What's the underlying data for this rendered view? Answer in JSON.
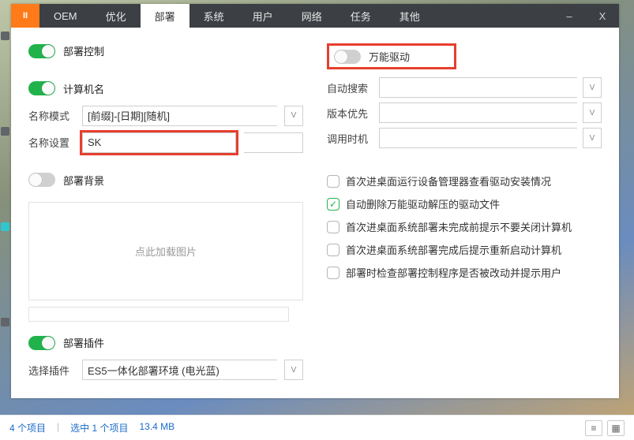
{
  "titlebar": {
    "logo": "II",
    "tabs": [
      "OEM",
      "优化",
      "部署",
      "系统",
      "用户",
      "网络",
      "任务",
      "其他"
    ],
    "active_tab_index": 2
  },
  "left": {
    "deploy_control": {
      "label": "部署控制",
      "on": true
    },
    "computer_name": {
      "label": "计算机名",
      "on": true,
      "name_mode_label": "名称模式",
      "name_mode_value": "[前缀]-[日期][随机]",
      "name_set_label": "名称设置",
      "name_set_value": "SK"
    },
    "deploy_bg": {
      "label": "部署背景",
      "on": false,
      "dropzone_text": "点此加载图片"
    },
    "deploy_plugin": {
      "label": "部署插件",
      "on": true,
      "select_label": "选择插件",
      "select_value": "ES5一体化部署环境 (电光蓝)"
    }
  },
  "right": {
    "wanneng": {
      "label": "万能驱动",
      "on": false
    },
    "rows": {
      "auto_search": {
        "label": "自动搜索",
        "value": ""
      },
      "version_pri": {
        "label": "版本优先",
        "value": ""
      },
      "call_timing": {
        "label": "调用时机",
        "value": ""
      }
    },
    "checks": [
      {
        "checked": false,
        "text": "首次进桌面运行设备管理器查看驱动安装情况"
      },
      {
        "checked": true,
        "text": "自动删除万能驱动解压的驱动文件"
      },
      {
        "checked": false,
        "text": "首次进桌面系统部署未完成前提示不要关闭计算机"
      },
      {
        "checked": false,
        "text": "首次进桌面系统部署完成后提示重新启动计算机"
      },
      {
        "checked": false,
        "text": "部署时检查部署控制程序是否被改动并提示用户"
      }
    ]
  },
  "statusbar": {
    "items": "4 个项目",
    "selected": "选中 1 个项目",
    "size": "13.4 MB"
  }
}
